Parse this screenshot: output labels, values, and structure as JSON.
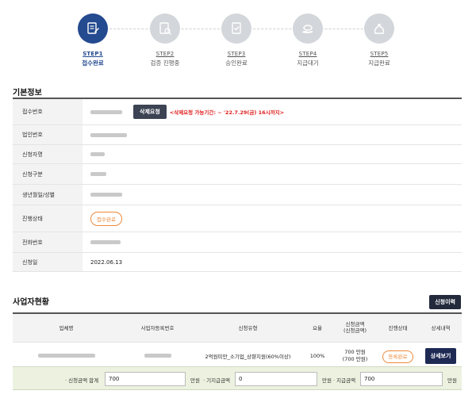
{
  "steps": [
    {
      "num": "STEP1",
      "label": "접수완료",
      "icon": "document-pen-icon",
      "active": true
    },
    {
      "num": "STEP2",
      "label": "검증 진행중",
      "icon": "document-search-icon",
      "active": false
    },
    {
      "num": "STEP3",
      "label": "승인완료",
      "icon": "approval-document-icon",
      "active": false
    },
    {
      "num": "STEP4",
      "label": "지급대기",
      "icon": "hand-money-icon",
      "active": false
    },
    {
      "num": "STEP5",
      "label": "지급완료",
      "icon": "money-bag-icon",
      "active": false
    }
  ],
  "basic_info": {
    "title": "기본정보",
    "rows": {
      "receipt_no": "접수번호",
      "corp_no": "법인번호",
      "applicant": "신청자명",
      "apply_type": "신청구분",
      "birth_gender": "생년월일/성별",
      "progress": "진행상태",
      "phone": "전화번호",
      "apply_date": "신청일"
    },
    "delete_button": "삭제요청",
    "delete_notice": "<삭제요청 가능기간: ~ '22.7.29(금) 16시까지>",
    "progress_status": "접수완료",
    "apply_date_value": "2022.06.13"
  },
  "biz": {
    "title": "사업자현황",
    "history_button": "신청이력",
    "headers": [
      "업체명",
      "사업자등록번호",
      "신청유형",
      "요율",
      "신청금액\n(신청금액)",
      "진행상태",
      "상세내역"
    ],
    "row": {
      "type": "2억원미만_소기업_상향지원(60%이상)",
      "rate": "100%",
      "amount1": "700 만원",
      "amount2": "(700 만원)",
      "status": "등록완료",
      "detail_button": "상세보기"
    }
  },
  "sum": {
    "total_label": "· 신청금액 합계",
    "total_value": "700",
    "unit1": "만원",
    "already_label": "· 기지급금액",
    "already_value": "0",
    "unit2": "만원",
    "pay_label": "· 지급금액",
    "pay_value": "700",
    "unit3": "만원"
  },
  "colors": {
    "active": "#244a8f",
    "inactive": "#d3d6da",
    "alert": "#e02020",
    "pill": "#ec8a3c"
  }
}
